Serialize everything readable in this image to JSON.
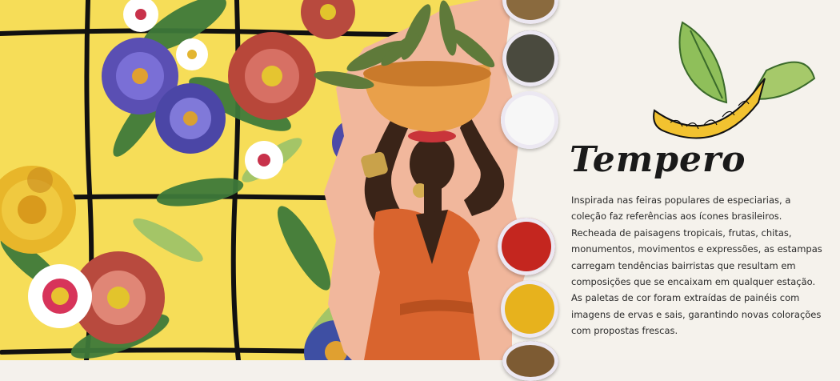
{
  "title": "Tempero",
  "description_lines": [
    "Inspirada nas feiras populares de especiarias, a",
    "coleção faz referências aos ícones brasileiros.",
    "Recheada de paisagens tropicais, frutas, chitas,",
    "monumentos, movimentos e expressões, as estampas",
    "carregam tendências bairristas que resultam em",
    "composições que se encaixam em qualquer estação.",
    "As paletas de cor foram extraídas de painéis com",
    "imagens de ervas e sais, garantindo novas colorações",
    "com propostas frescas."
  ],
  "colors": {
    "floral_background": "#f6dd58",
    "grid_lines": "#111111",
    "panel_background": "#f5f2ec",
    "dress": "#d9642e",
    "bowl": "#e9a04a",
    "banana": "#f2c230"
  },
  "spices": [
    {
      "name": "brown-spice",
      "color": "#8a6a3e"
    },
    {
      "name": "black-pepper",
      "color": "#4a4a3e"
    },
    {
      "name": "salt",
      "color": "#f7f7f7"
    },
    {
      "name": "paprika",
      "color": "#c4261f"
    },
    {
      "name": "turmeric",
      "color": "#e7b21d"
    },
    {
      "name": "cumin",
      "color": "#7d5b33"
    }
  ]
}
